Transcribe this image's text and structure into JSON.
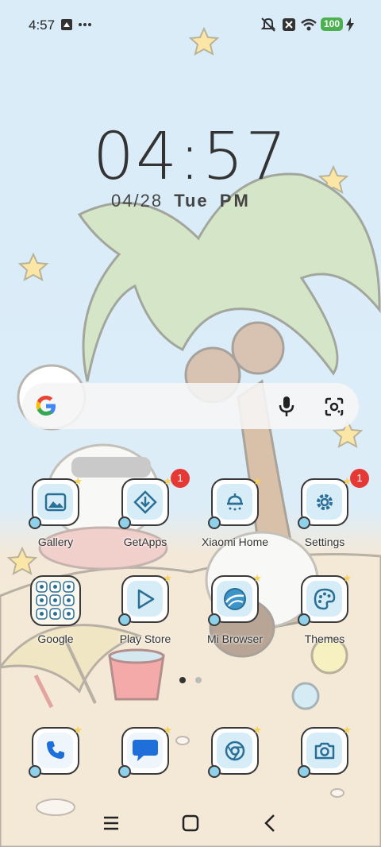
{
  "status_bar": {
    "time": "4:57",
    "battery": "100"
  },
  "lockclock": {
    "time": "04:57",
    "date": "04/28",
    "day": "Tue",
    "ampm": "PM"
  },
  "apps": [
    {
      "label": "Gallery",
      "icon": "gallery-icon",
      "badge": ""
    },
    {
      "label": "GetApps",
      "icon": "getapps-icon",
      "badge": "1"
    },
    {
      "label": "Xiaomi Home",
      "icon": "xiaomi-home-icon",
      "badge": ""
    },
    {
      "label": "Settings",
      "icon": "settings-icon",
      "badge": "1"
    },
    {
      "label": "Google",
      "icon": "google-folder-icon",
      "badge": ""
    },
    {
      "label": "Play Store",
      "icon": "play-store-icon",
      "badge": ""
    },
    {
      "label": "Mi Browser",
      "icon": "mi-browser-icon",
      "badge": ""
    },
    {
      "label": "Themes",
      "icon": "themes-icon",
      "badge": ""
    }
  ],
  "dock": [
    {
      "icon": "phone-icon"
    },
    {
      "icon": "messages-icon"
    },
    {
      "icon": "chrome-icon"
    },
    {
      "icon": "camera-icon"
    }
  ],
  "colors": {
    "sky": "#d9ecf8",
    "sand": "#f6eddc",
    "badge": "#e53935",
    "palm_leaf": "#cfe3c4",
    "trunk": "#d6b8a0"
  }
}
